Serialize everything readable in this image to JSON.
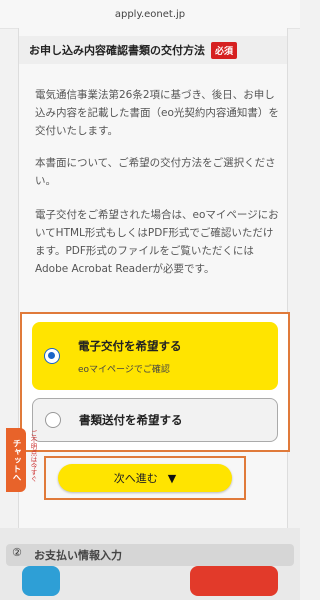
{
  "browser": {
    "url": "apply.eonet.jp"
  },
  "section": {
    "title": "お申し込み内容確認書類の交付方法",
    "required_badge": "必須",
    "paragraphs": [
      "電気通信事業法第26条2項に基づき、後日、お申し込み内容を記載した書面（eo光契約内容通知書）を交付いたします。",
      "本書面について、ご希望の交付方法をご選択ください。",
      "電子交付をご希望された場合は、eoマイページにおいてHTML形式もしくはPDF形式でご確認いただけます。PDF形式のファイルをご覧いただくにはAdobe Acrobat Readerが必要です。"
    ]
  },
  "options": [
    {
      "label": "電子交付を希望する",
      "sub": "eoマイページでご確認",
      "selected": true
    },
    {
      "label": "書類送付を希望する",
      "selected": false
    }
  ],
  "chat": {
    "label": "チャットへ",
    "note": "ご不明点は今すぐ"
  },
  "next_button": {
    "label": "次へ進む",
    "icon": "triangle-down"
  },
  "footer": {
    "partial_text": "お支払い情報入力"
  },
  "colors": {
    "accent_yellow": "#ffe400",
    "highlight_orange": "#e07a3a",
    "required_red": "#d62020",
    "radio_blue": "#1a64c8"
  }
}
